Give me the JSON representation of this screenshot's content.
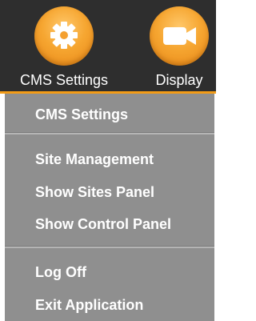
{
  "toolbar": {
    "cms_label": "CMS Settings",
    "display_label": "Display",
    "cms_icon": "gear-icon",
    "display_icon": "video-camera-icon",
    "accent_color": "#f39c17",
    "background_color": "#2e2e2e"
  },
  "menu": {
    "background_color": "#8f8f8f",
    "items": [
      {
        "label": "CMS Settings"
      },
      {
        "label": "Site Management"
      },
      {
        "label": "Show Sites Panel"
      },
      {
        "label": "Show Control Panel"
      },
      {
        "label": "Log Off"
      },
      {
        "label": "Exit Application"
      }
    ]
  }
}
